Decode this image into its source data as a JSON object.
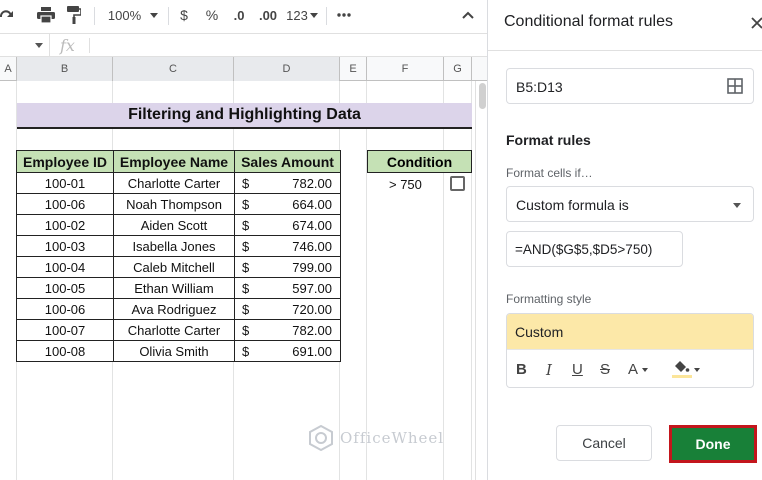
{
  "toolbar": {
    "zoom": "100%",
    "currency": "$",
    "percent": "%",
    "decrease_decimals": ".0",
    "increase_decimals": ".00",
    "number_format": "123"
  },
  "formula_bar": {
    "fx": "fx"
  },
  "columns": [
    "A",
    "B",
    "C",
    "D",
    "E",
    "F",
    "G"
  ],
  "sheet": {
    "title": "Filtering and Highlighting Data",
    "headers": [
      "Employee ID",
      "Employee Name",
      "Sales Amount"
    ],
    "currency_symbol": "$",
    "rows": [
      {
        "id": "100-01",
        "name": "Charlotte Carter",
        "amount": "782.00"
      },
      {
        "id": "100-06",
        "name": "Noah Thompson",
        "amount": "664.00"
      },
      {
        "id": "100-02",
        "name": "Aiden Scott",
        "amount": "674.00"
      },
      {
        "id": "100-03",
        "name": "Isabella Jones",
        "amount": "746.00"
      },
      {
        "id": "100-04",
        "name": "Caleb Mitchell",
        "amount": "799.00"
      },
      {
        "id": "100-05",
        "name": "Ethan William",
        "amount": "597.00"
      },
      {
        "id": "100-06",
        "name": "Ava Rodriguez",
        "amount": "720.00"
      },
      {
        "id": "100-07",
        "name": "Charlotte Carter",
        "amount": "782.00"
      },
      {
        "id": "100-08",
        "name": "Olivia Smith",
        "amount": "691.00"
      }
    ],
    "condition_header": "Condition",
    "condition_value": "> 750",
    "condition_checked": false
  },
  "watermark": "OfficeWheel",
  "panel": {
    "title": "Conditional format rules",
    "range": "B5:D13",
    "format_rules_label": "Format rules",
    "format_cells_if_label": "Format cells if…",
    "condition": "Custom formula is",
    "formula": "=AND($G$5,$D5>750)",
    "formatting_style_label": "Formatting style",
    "style_name": "Custom",
    "cancel_label": "Cancel",
    "done_label": "Done"
  },
  "colors": {
    "title_bg": "#dcd4ea",
    "header_bg": "#c5e1b5",
    "style_preview_bg": "#fce8a8",
    "done_bg": "#188038",
    "done_outline": "#c3161c"
  }
}
